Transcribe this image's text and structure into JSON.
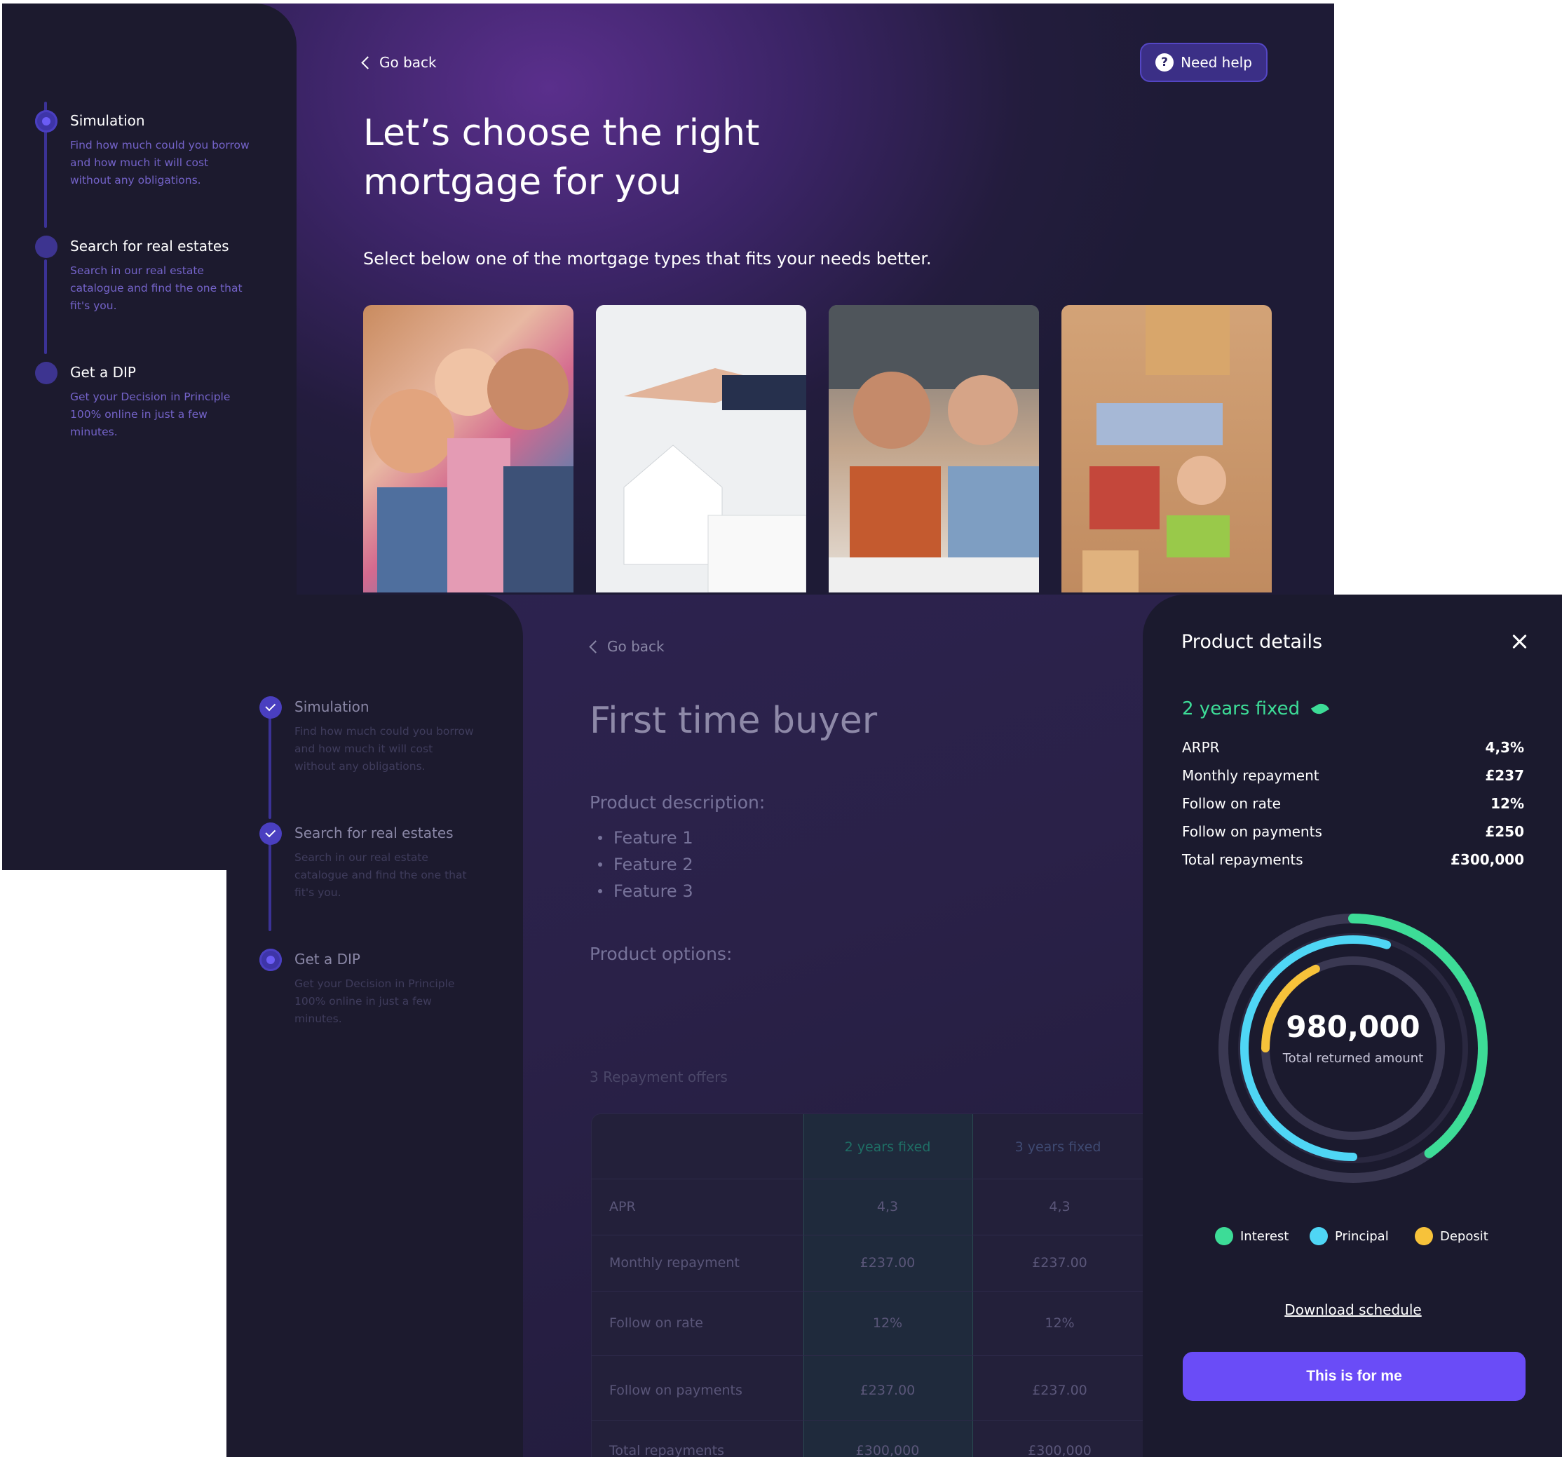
{
  "screen1": {
    "steps": [
      {
        "title": "Simulation",
        "desc": "Find how much could you borrow and how much it will cost without any obligations."
      },
      {
        "title": "Search for real estates",
        "desc": "Search in our real estate catalogue and find the one that fit's you."
      },
      {
        "title": "Get a DIP",
        "desc": "Get your Decision in Principle 100% online in just a few minutes."
      }
    ],
    "go_back": "Go back",
    "need_help": "Need help",
    "heading": "Let’s choose the right mortgage for you",
    "subheading": "Select below one of the mortgage types that fits your needs better.",
    "photos": [
      "family-photo",
      "handshake-house-photo",
      "couple-laptop-photo",
      "family-lying-floor-photo"
    ]
  },
  "screen2": {
    "steps": [
      {
        "title": "Simulation",
        "desc": "Find how much could you borrow and how much it will cost without any obligations."
      },
      {
        "title": "Search for real estates",
        "desc": "Search in our real estate catalogue and find the one that fit's you."
      },
      {
        "title": "Get a DIP",
        "desc": "Get your Decision in Principle 100% online in just a few minutes."
      }
    ],
    "go_back": "Go back",
    "heading": "First time buyer",
    "product_description_label": "Product description:",
    "features": [
      "Feature 1",
      "Feature 2",
      "Feature 3"
    ],
    "product_options_label": "Product options:",
    "offers_label": "3 Repayment offers",
    "table": {
      "columns": [
        "2 years fixed",
        "3 years fixed"
      ],
      "rows": [
        {
          "label": "APR",
          "values": [
            "4,3",
            "4,3"
          ]
        },
        {
          "label": "Monthly repayment",
          "values": [
            "£237.00",
            "£237.00"
          ]
        },
        {
          "label": "Follow on rate",
          "values": [
            "12%",
            "12%"
          ]
        },
        {
          "label": "Follow on payments",
          "values": [
            "£237.00",
            "£237.00"
          ]
        },
        {
          "label": "Total repayments",
          "values": [
            "£300,000",
            "£300,000"
          ]
        }
      ]
    }
  },
  "panel": {
    "title": "Product details",
    "product_name": "2 years fixed",
    "details": [
      {
        "label": "ARPR",
        "value": "4,3%"
      },
      {
        "label": "Monthly repayment",
        "value": "£237"
      },
      {
        "label": "Follow on rate",
        "value": "12%"
      },
      {
        "label": "Follow on payments",
        "value": "£250"
      },
      {
        "label": "Total repayments",
        "value": "£300,000"
      }
    ],
    "donut": {
      "value": "980,000",
      "label": "Total returned amount",
      "segments": [
        {
          "name": "Interest",
          "color": "#3ddc97",
          "fraction": 0.4
        },
        {
          "name": "Principal",
          "color": "#4fd6f5",
          "fraction": 0.55
        },
        {
          "name": "Deposit",
          "color": "#f7c23a",
          "fraction": 0.18
        }
      ]
    },
    "legend": [
      {
        "label": "Interest",
        "color": "#3ddc97"
      },
      {
        "label": "Principal",
        "color": "#4fd6f5"
      },
      {
        "label": "Deposit",
        "color": "#f7c23a"
      }
    ],
    "download": "Download schedule",
    "cta": "This is for me"
  }
}
